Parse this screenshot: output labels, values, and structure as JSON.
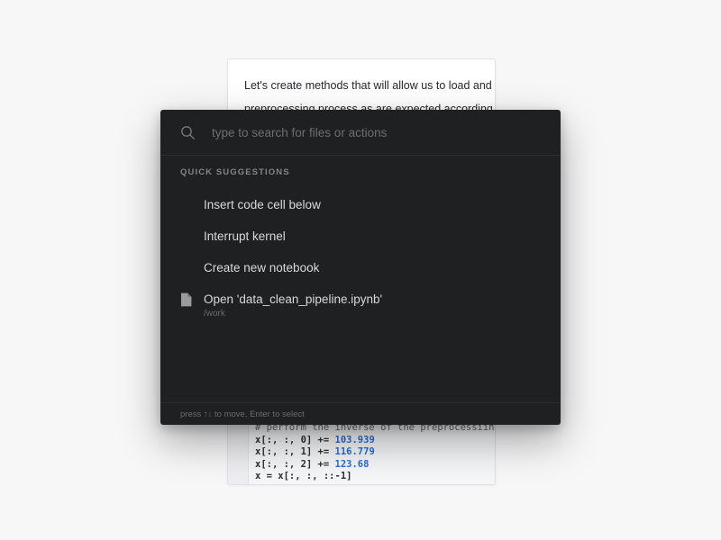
{
  "background_document": {
    "prose_lines": [
      "Let's create methods that will allow us to load and pre",
      "preprocessing process as are expected according to"
    ],
    "code": {
      "comment_line": "# perform the inverse of the preprocessiing st",
      "lines": [
        {
          "var": "x[:, :, 0] += ",
          "value": "103.939"
        },
        {
          "var": "x[:, :, 1] += ",
          "value": "116.779"
        },
        {
          "var": "x[:, :, 2] += ",
          "value": "123.68"
        }
      ],
      "clipped_line": "x = x[:, :, ::-1]"
    }
  },
  "palette": {
    "search": {
      "icon": "search-icon",
      "value": "",
      "placeholder": "type to search for files or actions"
    },
    "section_label": "QUICK SUGGESTIONS",
    "items": [
      {
        "title": "Insert code cell below",
        "subtitle": "",
        "icon": ""
      },
      {
        "title": "Interrupt kernel",
        "subtitle": "",
        "icon": ""
      },
      {
        "title": "Create new notebook",
        "subtitle": "",
        "icon": ""
      },
      {
        "title": "Open 'data_clean_pipeline.ipynb'",
        "subtitle": "/work",
        "icon": "file-icon"
      }
    ],
    "footer_hint": "press ↑↓ to move, Enter to select"
  },
  "colors": {
    "page_background": "#f7f7f8",
    "palette_background": "#1f2022",
    "card_background": "#ffffff",
    "code_background": "#f4f6f8",
    "code_number": "#2a6dd0",
    "text_primary": "#d9d9d9",
    "text_muted": "#6a6b6f"
  }
}
